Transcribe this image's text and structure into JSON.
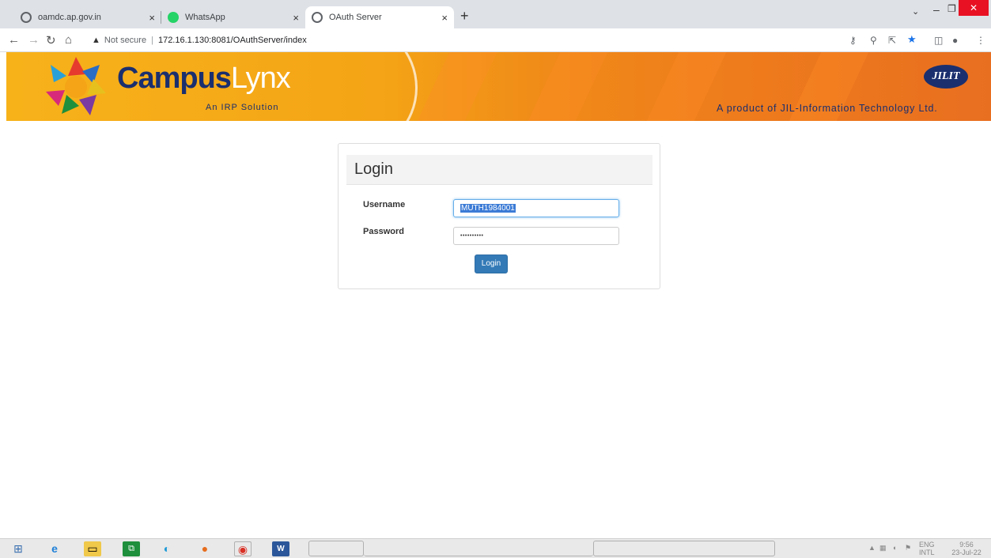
{
  "browser": {
    "tabs": [
      {
        "title": "oamdc.ap.gov.in",
        "active": false
      },
      {
        "title": "WhatsApp",
        "active": false
      },
      {
        "title": "OAuth Server",
        "active": true
      }
    ],
    "close_glyph": "×",
    "new_tab_glyph": "+",
    "security_label": "Not secure",
    "url": "172.16.1.130:8081/OAuthServer/index"
  },
  "banner": {
    "brand_part1": "Campus",
    "brand_part2": "Lynx",
    "tagline": "An IRP Solution",
    "company_logo": "JILIT",
    "product_text": "A product of JIL-Information Technology Ltd."
  },
  "login": {
    "title": "Login",
    "username_label": "Username",
    "username_value": "MUTH1984001",
    "password_label": "Password",
    "password_value": "••••••••••",
    "submit_label": "Login"
  },
  "taskbar": {
    "lang": "ENG",
    "region": "INTL",
    "time": "9:56",
    "date": "23-Jul-22"
  },
  "colors": {
    "banner_orange": "#f4a416",
    "brand_blue": "#1b2f6e",
    "button_blue": "#337ab7"
  }
}
